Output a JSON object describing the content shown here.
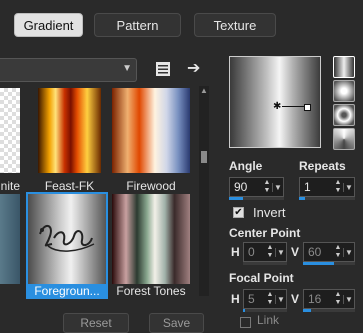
{
  "tabs": [
    {
      "label": "Gradient",
      "active": true
    },
    {
      "label": "Pattern",
      "active": false
    },
    {
      "label": "Texture",
      "active": false
    }
  ],
  "category_dropdown": {
    "value": ""
  },
  "icons": {
    "list": "list-icon",
    "arrow": "arrow-right-icon",
    "chevron": "chevron-down-icon",
    "spinner_up": "spinner-up-icon",
    "spinner_down": "spinner-down-icon"
  },
  "swatches": [
    {
      "label": "nite",
      "selected": false
    },
    {
      "label": "Feast-FK",
      "selected": false
    },
    {
      "label": "Firewood",
      "selected": false
    },
    {
      "label": "",
      "selected": false
    },
    {
      "label": "Foregroun...",
      "selected": true
    },
    {
      "label": "Forest Tones",
      "selected": false
    }
  ],
  "preview": {
    "center_marker": "✱"
  },
  "angle": {
    "label": "Angle",
    "value": "90",
    "level": 0.25
  },
  "repeats": {
    "label": "Repeats",
    "value": "1",
    "level": 0.1
  },
  "invert": {
    "label": "Invert",
    "checked": true
  },
  "center_point": {
    "label": "Center Point",
    "h_label": "H",
    "h_value": "0",
    "v_label": "V",
    "v_value": "60",
    "h_level": 0.0,
    "v_level": 0.6
  },
  "focal_point": {
    "label": "Focal Point",
    "h_label": "H",
    "h_value": "5",
    "v_label": "V",
    "v_value": "16",
    "h_level": 0.05,
    "v_level": 0.16
  },
  "buttons": {
    "reset": "Reset",
    "save": "Save"
  },
  "link": {
    "label": "Link",
    "checked": false
  },
  "colors": {
    "accent": "#2a8fe0",
    "background": "#2a2a2a"
  }
}
